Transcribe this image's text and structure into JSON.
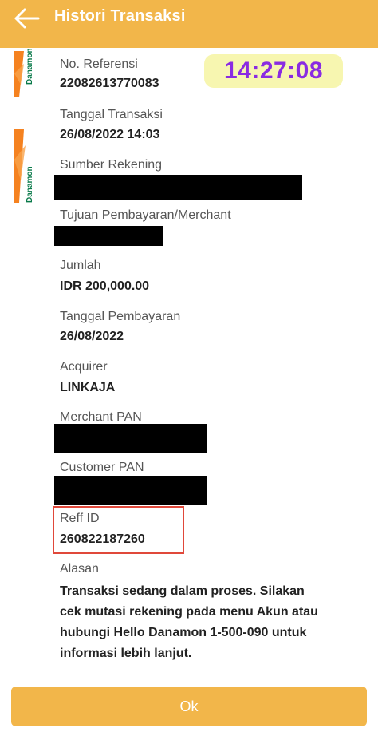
{
  "header": {
    "title": "Histori Transaksi"
  },
  "logo": {
    "text": "Danamon"
  },
  "time_badge": {
    "text": "14:27:08"
  },
  "fields": {
    "no_referensi": {
      "label": "No. Referensi",
      "value": "22082613770083"
    },
    "tanggal_transaksi": {
      "label": "Tanggal Transaksi",
      "value": "26/08/2022 14:03"
    },
    "sumber_rekening": {
      "label": "Sumber Rekening"
    },
    "tujuan_pembayaran": {
      "label": "Tujuan Pembayaran/Merchant"
    },
    "jumlah": {
      "label": "Jumlah",
      "value": "IDR 200,000.00"
    },
    "tanggal_pembayaran": {
      "label": "Tanggal Pembayaran",
      "value": "26/08/2022"
    },
    "acquirer": {
      "label": "Acquirer",
      "value": "LINKAJA"
    },
    "merchant_pan": {
      "label": "Merchant PAN"
    },
    "customer_pan": {
      "label": "Customer PAN"
    },
    "reff_id": {
      "label": "Reff ID",
      "value": "260822187260"
    },
    "alasan": {
      "label": "Alasan",
      "value": "Transaksi sedang dalam proses. Silakan cek mutasi rekening pada menu Akun atau hubungi Hello Danamon 1-500-090 untuk informasi lebih lanjut."
    }
  },
  "ok_button": {
    "label": "Ok"
  },
  "colors": {
    "accent": "#f2b64a",
    "badge_bg": "#f7f6b0",
    "badge_text": "#8a2be2",
    "highlight": "#e0483a"
  }
}
